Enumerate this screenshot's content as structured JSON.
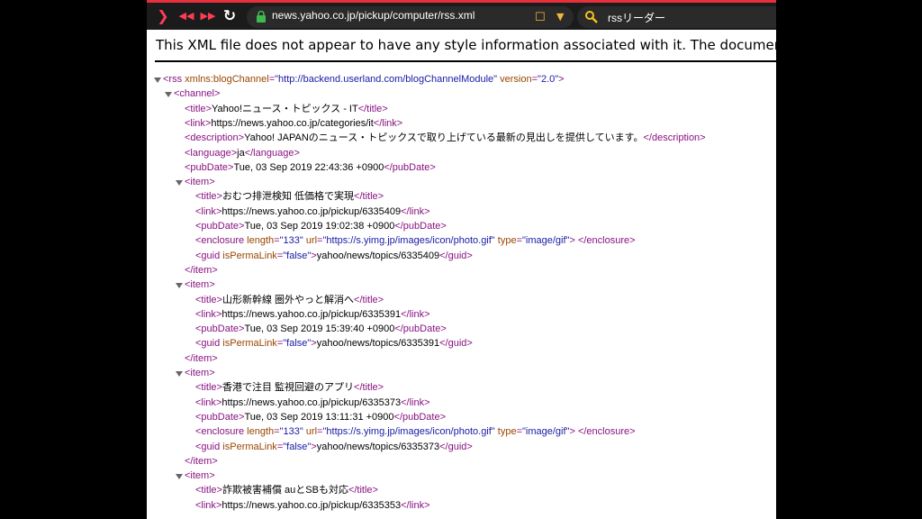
{
  "browser": {
    "url": "news.yahoo.co.jp/pickup/computer/rss.xml",
    "search_text": "rssリーダー"
  },
  "info_text": "This XML file does not appear to have any style information associated with it. The document tree is shown below.",
  "rss": {
    "rss_attrs": [
      {
        "name": "xmlns:blogChannel",
        "value": "\"http://backend.userland.com/blogChannelModule\""
      },
      {
        "name": "version",
        "value": "\"2.0\""
      }
    ],
    "channel": {
      "title": "Yahoo!ニュース・トピックス - IT",
      "link": "https://news.yahoo.co.jp/categories/it",
      "description": "Yahoo! JAPANのニュース・トピックスで取り上げている最新の見出しを提供しています。",
      "language": "ja",
      "pubDate": "Tue, 03 Sep 2019 22:43:36 +0900"
    },
    "items": [
      {
        "title": "おむつ排泄検知 低価格で実現",
        "link": "https://news.yahoo.co.jp/pickup/6335409",
        "pubDate": "Tue, 03 Sep 2019 19:02:38 +0900",
        "enclosure": {
          "length": "\"133\"",
          "url": "\"https://s.yimg.jp/images/icon/photo.gif\"",
          "type": "\"image/gif\""
        },
        "guid_isPermaLink": "\"false\"",
        "guid": "yahoo/news/topics/6335409"
      },
      {
        "title": "山形新幹線 圏外やっと解消へ",
        "link": "https://news.yahoo.co.jp/pickup/6335391",
        "pubDate": "Tue, 03 Sep 2019 15:39:40 +0900",
        "guid_isPermaLink": "\"false\"",
        "guid": "yahoo/news/topics/6335391"
      },
      {
        "title": "香港で注目 監視回避のアプリ",
        "link": "https://news.yahoo.co.jp/pickup/6335373",
        "pubDate": "Tue, 03 Sep 2019 13:11:31 +0900",
        "enclosure": {
          "length": "\"133\"",
          "url": "\"https://s.yimg.jp/images/icon/photo.gif\"",
          "type": "\"image/gif\""
        },
        "guid_isPermaLink": "\"false\"",
        "guid": "yahoo/news/topics/6335373"
      },
      {
        "title": "詐欺被害補償 auとSBも対応",
        "link": "https://news.yahoo.co.jp/pickup/6335353"
      }
    ]
  }
}
